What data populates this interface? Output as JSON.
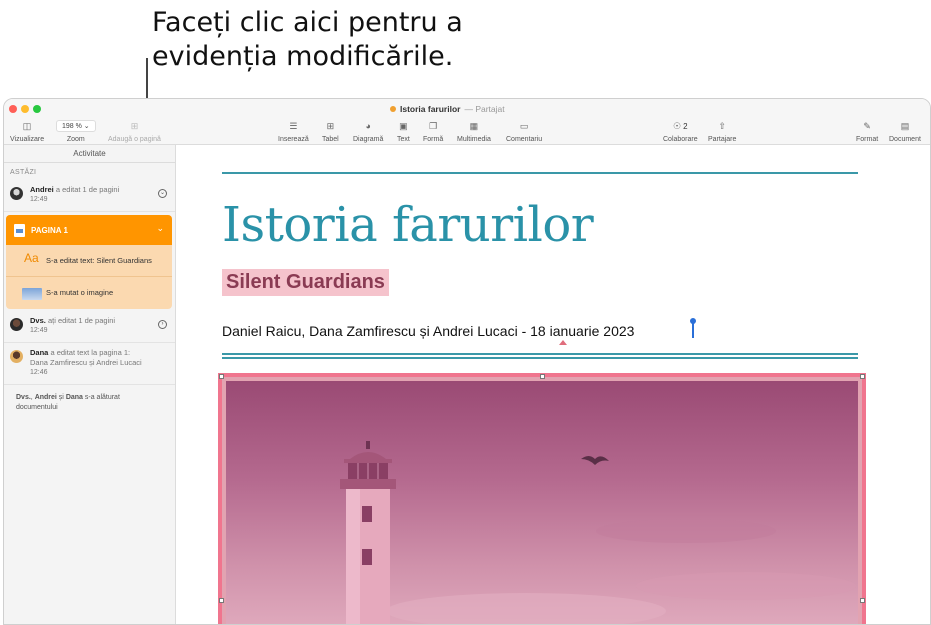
{
  "callout": {
    "line1": "Faceți clic aici pentru a",
    "line2": "evidenția modificările."
  },
  "window": {
    "doc_name": "Istoria farurilor",
    "doc_status": "— Partajat"
  },
  "toolbar": {
    "view": "Vizualizare",
    "zoom_value": "198 %",
    "zoom": "Zoom",
    "add_page": "Adaugă o pagină",
    "insert": "Inserează",
    "table": "Tabel",
    "chart": "Diagramă",
    "text": "Text",
    "shape": "Formă",
    "media": "Multimedia",
    "comment": "Comentariu",
    "collab_count": "2",
    "collab": "Colaborare",
    "share": "Partajare",
    "format": "Format",
    "document": "Document"
  },
  "sidebar": {
    "header": "Activitate",
    "section": "ASTĂZI",
    "a1": {
      "user": "Andrei",
      "action": "a editat 1 de pagini",
      "time": "12:49"
    },
    "page_group": {
      "label": "PAGINA 1",
      "item1": "S-a editat text: Silent Guardians",
      "item1_icon": "Aa",
      "item2": "S-a mutat o imagine"
    },
    "a2": {
      "user": "Dvs.",
      "action": "ați editat 1 de pagini",
      "time": "12:49"
    },
    "a3": {
      "user": "Dana",
      "action": "a editat text la pagina 1:",
      "detail": "Dana Zamfirescu și Andrei Lucaci",
      "time": "12:46"
    },
    "joined": {
      "u1": "Dvs.",
      "sep1": ", ",
      "u2": "Andrei",
      "sep2": " și ",
      "u3": "Dana",
      "action": " s-a alăturat documentului"
    }
  },
  "document": {
    "title": "Istoria farurilor",
    "subtitle": "Silent Guardians",
    "byline": "Daniel Raicu, Dana Zamfirescu și Andrei Lucaci - 18 ianuarie 2023"
  }
}
